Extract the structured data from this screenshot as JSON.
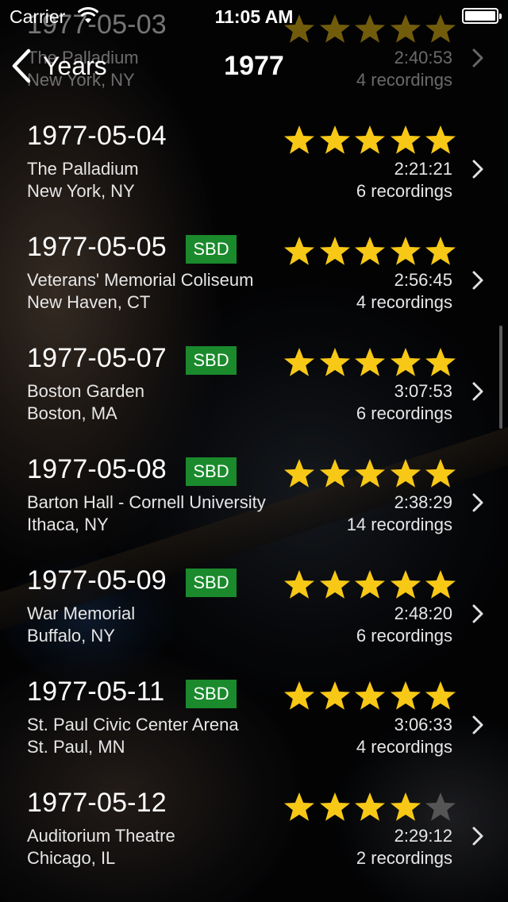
{
  "status_bar": {
    "carrier": "Carrier",
    "time": "11:05 AM"
  },
  "nav": {
    "back_label": "Years",
    "title": "1977"
  },
  "colors": {
    "star": "#f7c816",
    "star_empty": "#555555",
    "sbd_badge": "#1a8a2c"
  },
  "shows": [
    {
      "date": "1977-05-03",
      "sbd": false,
      "rating": 5,
      "venue": "The Palladium",
      "city": "New York, NY",
      "duration": "2:40:53",
      "recordings": "4 recordings"
    },
    {
      "date": "1977-05-04",
      "sbd": false,
      "rating": 5,
      "venue": "The Palladium",
      "city": "New York, NY",
      "duration": "2:21:21",
      "recordings": "6 recordings"
    },
    {
      "date": "1977-05-05",
      "sbd": true,
      "sbd_label": "SBD",
      "rating": 5,
      "venue": "Veterans' Memorial Coliseum",
      "city": "New Haven, CT",
      "duration": "2:56:45",
      "recordings": "4 recordings"
    },
    {
      "date": "1977-05-07",
      "sbd": true,
      "sbd_label": "SBD",
      "rating": 5,
      "venue": "Boston Garden",
      "city": "Boston, MA",
      "duration": "3:07:53",
      "recordings": "6 recordings"
    },
    {
      "date": "1977-05-08",
      "sbd": true,
      "sbd_label": "SBD",
      "rating": 5,
      "venue": "Barton Hall - Cornell University",
      "city": "Ithaca, NY",
      "duration": "2:38:29",
      "recordings": "14 recordings"
    },
    {
      "date": "1977-05-09",
      "sbd": true,
      "sbd_label": "SBD",
      "rating": 5,
      "venue": "War Memorial",
      "city": "Buffalo, NY",
      "duration": "2:48:20",
      "recordings": "6 recordings"
    },
    {
      "date": "1977-05-11",
      "sbd": true,
      "sbd_label": "SBD",
      "rating": 5,
      "venue": "St. Paul Civic Center Arena",
      "city": "St. Paul, MN",
      "duration": "3:06:33",
      "recordings": "4 recordings"
    },
    {
      "date": "1977-05-12",
      "sbd": false,
      "rating": 4,
      "venue": "Auditorium Theatre",
      "city": "Chicago, IL",
      "duration": "2:29:12",
      "recordings": "2 recordings"
    }
  ]
}
